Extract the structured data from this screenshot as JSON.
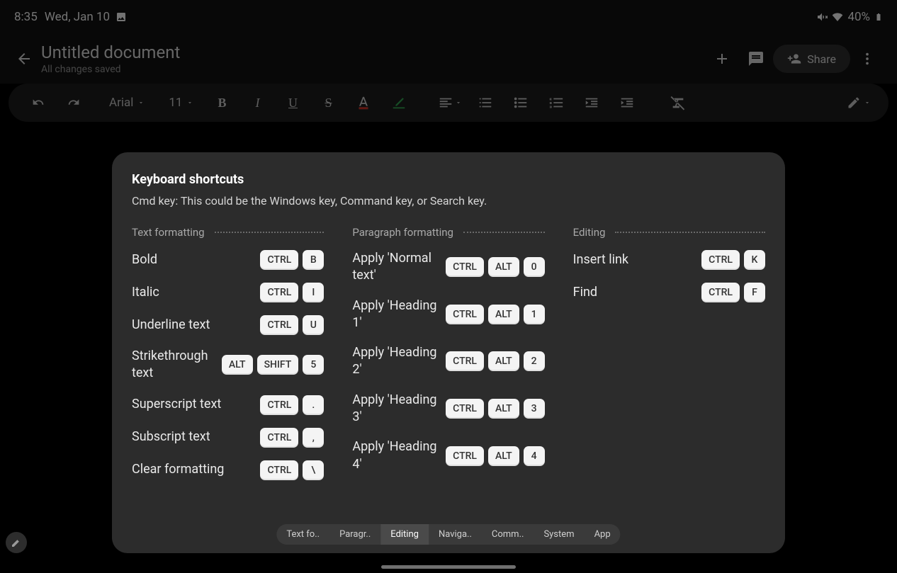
{
  "status": {
    "time": "8:35",
    "date": "Wed, Jan 10",
    "battery": "40%"
  },
  "header": {
    "title": "Untitled document",
    "subtitle": "All changes saved",
    "share": "Share"
  },
  "toolbar": {
    "font": "Arial",
    "size": "11"
  },
  "dialog": {
    "title": "Keyboard shortcuts",
    "subtitle": "Cmd key: This could be the Windows key, Command key, or Search key.",
    "sections": [
      {
        "name": "Text formatting",
        "items": [
          {
            "label": "Bold",
            "keys": [
              "CTRL",
              "B"
            ]
          },
          {
            "label": "Italic",
            "keys": [
              "CTRL",
              "I"
            ]
          },
          {
            "label": "Underline text",
            "keys": [
              "CTRL",
              "U"
            ]
          },
          {
            "label": "Strikethrough text",
            "keys": [
              "ALT",
              "SHIFT",
              "5"
            ]
          },
          {
            "label": "Superscript text",
            "keys": [
              "CTRL",
              "."
            ]
          },
          {
            "label": "Subscript text",
            "keys": [
              "CTRL",
              ","
            ]
          },
          {
            "label": "Clear formatting",
            "keys": [
              "CTRL",
              "\\"
            ]
          }
        ]
      },
      {
        "name": "Paragraph formatting",
        "items": [
          {
            "label": "Apply 'Normal text'",
            "keys": [
              "CTRL",
              "ALT",
              "0"
            ]
          },
          {
            "label": "Apply 'Heading 1'",
            "keys": [
              "CTRL",
              "ALT",
              "1"
            ]
          },
          {
            "label": "Apply 'Heading 2'",
            "keys": [
              "CTRL",
              "ALT",
              "2"
            ]
          },
          {
            "label": "Apply 'Heading 3'",
            "keys": [
              "CTRL",
              "ALT",
              "3"
            ]
          },
          {
            "label": "Apply 'Heading 4'",
            "keys": [
              "CTRL",
              "ALT",
              "4"
            ]
          }
        ]
      },
      {
        "name": "Editing",
        "items": [
          {
            "label": "Insert link",
            "keys": [
              "CTRL",
              "K"
            ]
          },
          {
            "label": "Find",
            "keys": [
              "CTRL",
              "F"
            ]
          }
        ]
      }
    ],
    "tabs": [
      "Text fo..",
      "Paragr..",
      "Editing",
      "Naviga..",
      "Comm..",
      "System",
      "App"
    ],
    "tabs_active": 2
  }
}
